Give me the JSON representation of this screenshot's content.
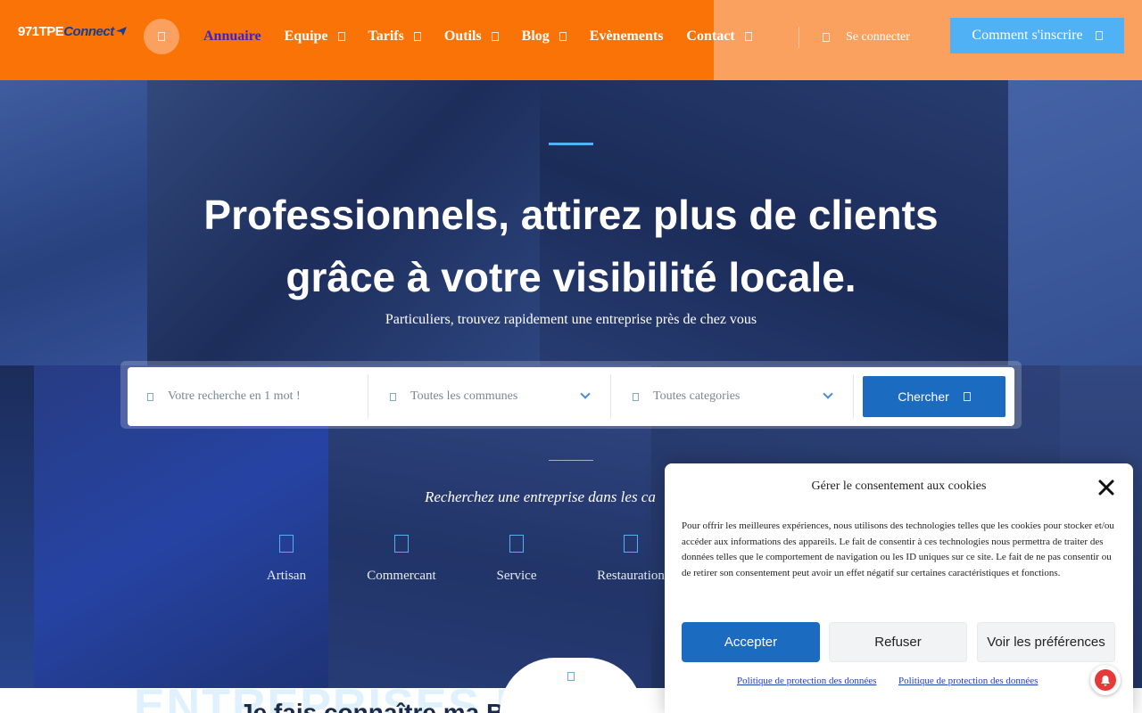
{
  "header": {
    "logo": {
      "part1": "971TPE",
      "part2": "Connect"
    },
    "nav": [
      {
        "label": "Annuaire",
        "active": true,
        "dropdown": false
      },
      {
        "label": "Equipe",
        "active": false,
        "dropdown": true
      },
      {
        "label": "Tarifs",
        "active": false,
        "dropdown": true
      },
      {
        "label": "Outils",
        "active": false,
        "dropdown": true
      },
      {
        "label": "Blog",
        "active": false,
        "dropdown": true
      },
      {
        "label": "Evènements",
        "active": false,
        "dropdown": false
      },
      {
        "label": "Contact",
        "active": false,
        "dropdown": true
      }
    ],
    "login_label": "Se connecter",
    "signup_label": "Comment s'inscrire"
  },
  "hero": {
    "title_line1": "Professionnels, attirez plus de clients",
    "title_line2": "grâce à votre visibilité locale.",
    "subtitle": "Particuliers, trouvez rapidement une entreprise près de chez vous"
  },
  "search": {
    "keyword_placeholder": "Votre recherche en 1 mot !",
    "commune_selected": "Toutes les communes",
    "category_selected": "Toutes categories",
    "button_label": "Chercher"
  },
  "categories": {
    "heading": "Recherchez une entreprise dans les ca",
    "items": [
      "Artisan",
      "Commercant",
      "Service",
      "Restauration"
    ]
  },
  "bottom": {
    "ghost_text": "ENTREPRISES DE G",
    "title": "Je fais connaître ma Boîte d"
  },
  "cookie": {
    "title": "Gérer le consentement aux cookies",
    "body": "Pour offrir les meilleures expériences, nous utilisons des technologies telles que les cookies pour stocker et/ou accéder aux informations des appareils. Le fait de consentir à ces technologies nous permettra de traiter des données telles que le comportement de navigation ou les ID uniques sur ce site. Le fait de ne pas consentir ou de retirer son consentement peut avoir un effet négatif sur certaines caractéristiques et fonctions.",
    "accept_label": "Accepter",
    "refuse_label": "Refuser",
    "prefs_label": "Voir les préférences",
    "link1": "Politique de protection des données",
    "link2": "Politique de protection des données"
  },
  "colors": {
    "header_orange": "#f97306",
    "header_light_orange": "#fba15f",
    "accent_blue": "#50b2f4",
    "button_blue": "#1b6bc1",
    "active_nav": "#3a24c7"
  }
}
